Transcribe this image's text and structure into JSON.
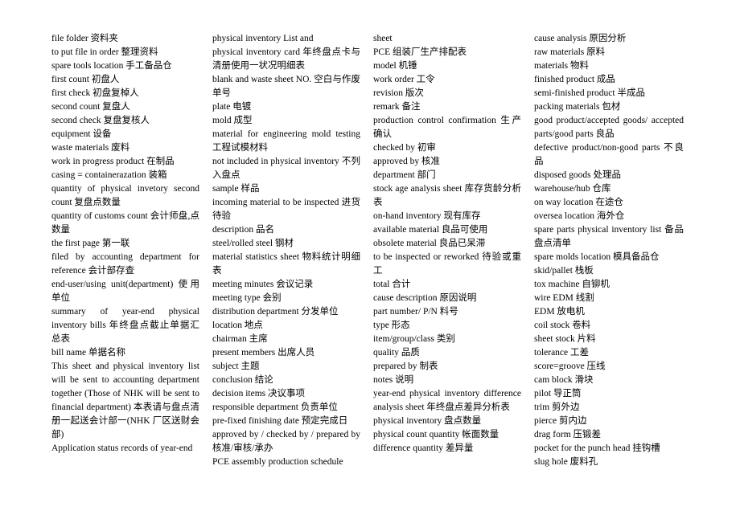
{
  "document": {
    "title": "Bilingual English-Chinese Manufacturing / Inventory Glossary",
    "layout": "four-column justified text list",
    "columns": [
      {
        "name": "column-1",
        "entries": [
          "file folder 资料夹",
          "to put file in order 整理资料",
          "spare tools location 手工备品仓",
          "first count 初盘人",
          "first check 初盘复棹人",
          "second count  复盘人",
          "second check 复盘复核人",
          "equipment 设备",
          "waste materials 废料",
          "work in progress product 在制品",
          "casing = containerazation 装箱",
          "quantity of physical invetory second count  复盘点数量",
          "quantity of customs count 会计师盘,点数量",
          "the first page 第一联",
          "filed by accounting department for reference 会计部存查",
          "end-user/using unit(department) 使用单位",
          "summary of year-end physical inventory bills 年终盘点截止单据汇总表",
          "bill name 单据名称",
          "This sheet and physical inventory list will be sent to accounting department together (Those of NHK will be sent to financial department) 本表请与盘点清册一起送会计部一(NHK 厂区送财会部)",
          "Application status records of year-end"
        ]
      },
      {
        "name": "column-2",
        "entries": [
          "physical inventory List and",
          "physical inventory card 年终盘点卡与清册使用一状况明细表",
          "blank and waste sheet NO. 空白与作废单号",
          "plate 电镀",
          "mold 成型",
          "material for engineering mold testing 工程试模材料",
          "not included in physical inventory 不列入盘点",
          "sample 样品",
          "incoming material to be inspected 进货待验",
          "description 品名",
          "steel/rolled steel 钢材",
          "material statistics sheet 物料统计明细表",
          "meeting minutes 会议记录",
          "meeting type  会别",
          "distribution department 分发单位",
          "location 地点",
          "chairman 主席",
          "present members 出席人员",
          "subject 主题",
          "conclusion 结论",
          "decision items 决议事项",
          "responsible department 负责单位",
          "pre-fixed finishing date 预定完成日",
          "approved by / checked by / prepared by 核准/审核/承办",
          "PCE assembly production schedule"
        ]
      },
      {
        "name": "column-3",
        "entries": [
          "sheet",
          "PCE 组装厂生产排配表",
          "model 机锤",
          "work order 工令",
          "revision 版次",
          "remark 备注",
          "production control confirmation 生产确认",
          "checked by 初审",
          "approved by 核准",
          "department 部门",
          "stock age analysis sheet 库存货龄分析表",
          "on-hand inventory 现有库存",
          "available material 良品可使用",
          "obsolete material 良品已呆滞",
          "to be inspected or reworked 待验或重工",
          "total 合计",
          "cause description 原因说明",
          "part number/ P/N  料号",
          "type 形态",
          "item/group/class 类别",
          "quality 品质",
          "prepared by 制表",
          "notes 说明",
          "year-end physical inventory difference analysis sheet 年终盘点差异分析表",
          "physical inventory 盘点数量",
          "physical count quantity 帐面数量",
          "difference quantity 差异量"
        ]
      },
      {
        "name": "column-4",
        "entries": [
          "cause analysis 原因分析",
          "raw materials 原料",
          "materials 物料",
          "finished product 成品",
          "semi-finished product 半成品",
          "packing materials 包材",
          "good product/accepted goods/ accepted parts/good parts 良品",
          "defective product/non-good parts 不良品",
          "disposed goods 处理品",
          "warehouse/hub 仓库",
          "on way location 在途仓",
          "oversea location 海外仓",
          "spare parts physical inventory list 备品盘点清单",
          "spare molds location 模具备品仓",
          "skid/pallet 栈板",
          "tox machine 自铆机",
          "wire EDM 线割",
          "EDM 放电机",
          "coil stock 卷料",
          "sheet stock 片料",
          "tolerance 工差",
          "score=groove 压线",
          "cam block 滑块",
          "pilot 导正筒",
          "trim 剪外边",
          "pierce 剪内边",
          "drag form 压锻差",
          "pocket for the punch head 挂钩槽",
          "slug hole 废料孔"
        ]
      }
    ]
  }
}
